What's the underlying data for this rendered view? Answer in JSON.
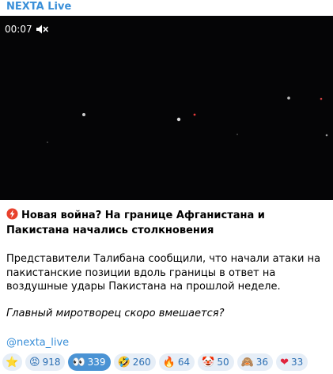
{
  "channel": {
    "name": "NEXTA Live"
  },
  "video": {
    "time": "00:07"
  },
  "post": {
    "title": "Новая война? На границе Афганистана и Пакистана начались столкновения",
    "body": "Представители Талибана сообщили, что начали атаки на пакистанские позиции вдоль границы в ответ на воздушные удары Пакистана на прошлой неделе.",
    "italic": "Главный миротворец скоро вмешается?",
    "link": "@nexta_live"
  },
  "reactions": [
    {
      "emoji": "⭐",
      "count": "",
      "icon": "star-icon"
    },
    {
      "emoji": "😡",
      "count": "918",
      "icon": "angry-face-icon"
    },
    {
      "emoji": "👀",
      "count": "339",
      "icon": "eyes-icon"
    },
    {
      "emoji": "🤣",
      "count": "260",
      "icon": "rofl-face-icon"
    },
    {
      "emoji": "🔥",
      "count": "64",
      "icon": "fire-icon"
    },
    {
      "emoji": "🤡",
      "count": "50",
      "icon": "clown-face-icon"
    },
    {
      "emoji": "🙈",
      "count": "36",
      "icon": "see-no-evil-monkey-icon"
    },
    {
      "emoji": "❤",
      "count": "33",
      "icon": "heart-icon"
    }
  ],
  "colors": {
    "link": "#3a8fd8",
    "reaction_bg": "#e6eef7",
    "reaction_selected_bg": "#4a93d4",
    "video_bg": "#050506"
  }
}
